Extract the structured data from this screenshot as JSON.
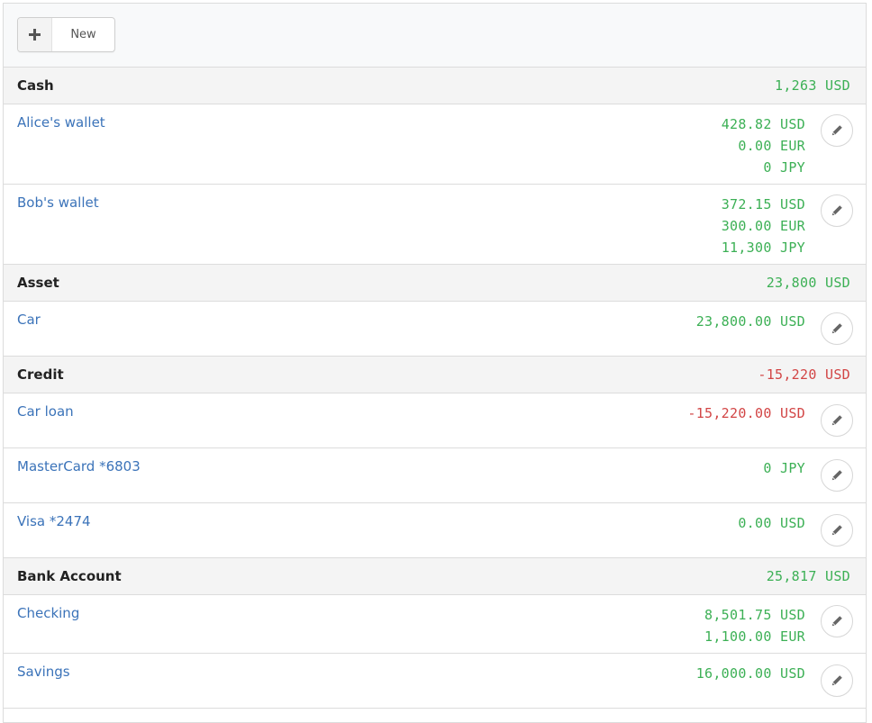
{
  "toolbar": {
    "new_label": "New"
  },
  "groups": [
    {
      "title": "Cash",
      "total": "1,263 USD",
      "total_negative": false,
      "accounts": [
        {
          "name": "Alice's wallet",
          "amounts": [
            "428.82 USD",
            "0.00 EUR",
            "0 JPY"
          ],
          "negative": false
        },
        {
          "name": "Bob's wallet",
          "amounts": [
            "372.15 USD",
            "300.00 EUR",
            "11,300 JPY"
          ],
          "negative": false
        }
      ]
    },
    {
      "title": "Asset",
      "total": "23,800 USD",
      "total_negative": false,
      "accounts": [
        {
          "name": "Car",
          "amounts": [
            "23,800.00 USD"
          ],
          "negative": false
        }
      ]
    },
    {
      "title": "Credit",
      "total": "-15,220 USD",
      "total_negative": true,
      "accounts": [
        {
          "name": "Car loan",
          "amounts": [
            "-15,220.00 USD"
          ],
          "negative": true
        },
        {
          "name": "MasterCard *6803",
          "amounts": [
            "0 JPY"
          ],
          "negative": false
        },
        {
          "name": "Visa *2474",
          "amounts": [
            "0.00 USD"
          ],
          "negative": false
        }
      ]
    },
    {
      "title": "Bank Account",
      "total": "25,817 USD",
      "total_negative": false,
      "accounts": [
        {
          "name": "Checking",
          "amounts": [
            "8,501.75 USD",
            "1,100.00 EUR"
          ],
          "negative": false
        },
        {
          "name": "Savings",
          "amounts": [
            "16,000.00 USD"
          ],
          "negative": false
        }
      ]
    }
  ],
  "icons": {
    "new": "plus-icon",
    "edit": "pencil-icon"
  },
  "colors": {
    "positive": "#3cb055",
    "negative": "#d24545",
    "link": "#3b73b9"
  }
}
